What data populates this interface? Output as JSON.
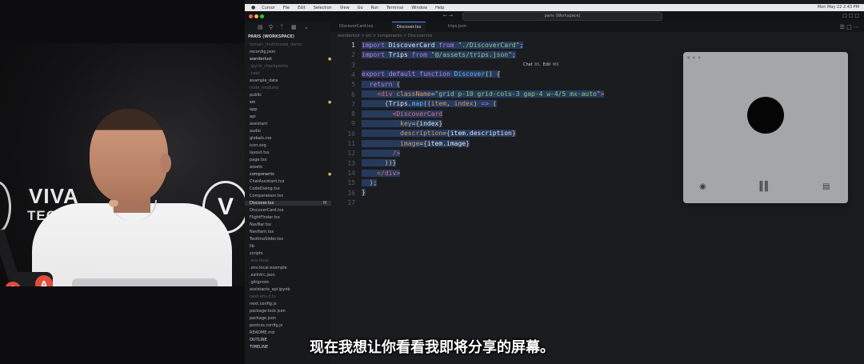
{
  "camera": {
    "brand_line1": "VIVA",
    "brand_line2": "TEC",
    "logo_letter": "V",
    "edge_letter": "G",
    "mic_logo": "A"
  },
  "menubar": {
    "items": [
      "Cursor",
      "File",
      "Edit",
      "Selection",
      "View",
      "Go",
      "Run",
      "Terminal",
      "Window",
      "Help"
    ],
    "clock": "Mon May 22 2:43 PM"
  },
  "titlebar": {
    "search": "paris (Workspace)"
  },
  "explorer": {
    "header": "PARIS (WORKSPACE)",
    "items": [
      {
        "label": "romain_multimodal_demo",
        "cls": "dim"
      },
      {
        "label": "recordig.json",
        "cls": ""
      },
      {
        "label": "wanderlust",
        "cls": "folder",
        "mark": "●"
      },
      {
        "label": ".ipynb_checkpoints",
        "cls": "dim"
      },
      {
        "label": ".next",
        "cls": "dim"
      },
      {
        "label": "example_data",
        "cls": ""
      },
      {
        "label": "node_modules",
        "cls": "dim"
      },
      {
        "label": "public",
        "cls": ""
      },
      {
        "label": "src",
        "cls": "folder",
        "mark": "●"
      },
      {
        "label": "app",
        "cls": ""
      },
      {
        "label": "api",
        "cls": ""
      },
      {
        "label": "assistant",
        "cls": ""
      },
      {
        "label": "audio",
        "cls": ""
      },
      {
        "label": "globals.css",
        "cls": ""
      },
      {
        "label": "icon.svg",
        "cls": ""
      },
      {
        "label": "layout.tsx",
        "cls": ""
      },
      {
        "label": "page.tsx",
        "cls": ""
      },
      {
        "label": "assets",
        "cls": ""
      },
      {
        "label": "components",
        "cls": "folder",
        "mark": "●"
      },
      {
        "label": "ChatAssistant.tsx",
        "cls": ""
      },
      {
        "label": "CodeDialog.tsx",
        "cls": ""
      },
      {
        "label": "Comparaison.tsx",
        "cls": ""
      },
      {
        "label": "Discover.tsx",
        "cls": "active",
        "mark": "M"
      },
      {
        "label": "DiscoverCard.tsx",
        "cls": ""
      },
      {
        "label": "FlightFinder.tsx",
        "cls": ""
      },
      {
        "label": "NavBar.tsx",
        "cls": ""
      },
      {
        "label": "NavItem.tsx",
        "cls": ""
      },
      {
        "label": "TestimoSlider.tsx",
        "cls": ""
      },
      {
        "label": "lib",
        "cls": ""
      },
      {
        "label": "scripts",
        "cls": ""
      },
      {
        "label": ".env.local",
        "cls": "dim"
      },
      {
        "label": ".env.local.example",
        "cls": ""
      },
      {
        "label": ".eslintrc.json",
        "cls": ""
      },
      {
        "label": ".gitignore",
        "cls": ""
      },
      {
        "label": "assistants_api.ipynb",
        "cls": ""
      },
      {
        "label": "next-env.d.ts",
        "cls": "dim"
      },
      {
        "label": "next.config.js",
        "cls": ""
      },
      {
        "label": "package-lock.json",
        "cls": ""
      },
      {
        "label": "package.json",
        "cls": ""
      },
      {
        "label": "postcss.config.js",
        "cls": ""
      },
      {
        "label": "README.md",
        "cls": ""
      },
      {
        "label": "OUTLINE",
        "cls": "folder"
      },
      {
        "label": "TIMELINE",
        "cls": "folder"
      }
    ]
  },
  "editor": {
    "tabs": [
      "DiscoverCard.tsx",
      "Discover.tsx",
      "trips.json"
    ],
    "breadcrumb": "wanderlust > src > components > Discover.tsx",
    "hint_chat": "Chat",
    "hint_chat_kb": "⌘L",
    "hint_edit": "Edit",
    "hint_edit_kb": "⌘K",
    "line_numbers": [
      "1",
      "2",
      "3",
      "4",
      "5",
      "6",
      "7",
      "8",
      "9",
      "10",
      "11",
      "12",
      "13",
      "14",
      "15",
      "16",
      "17"
    ]
  },
  "preview": {
    "dots": "● ● ●",
    "camera_icon": "camera-icon",
    "waveform_icon": "waveform-icon",
    "screen_icon": "screen-icon"
  },
  "subtitle": "现在我想让你看看我即将分享的屏幕。"
}
